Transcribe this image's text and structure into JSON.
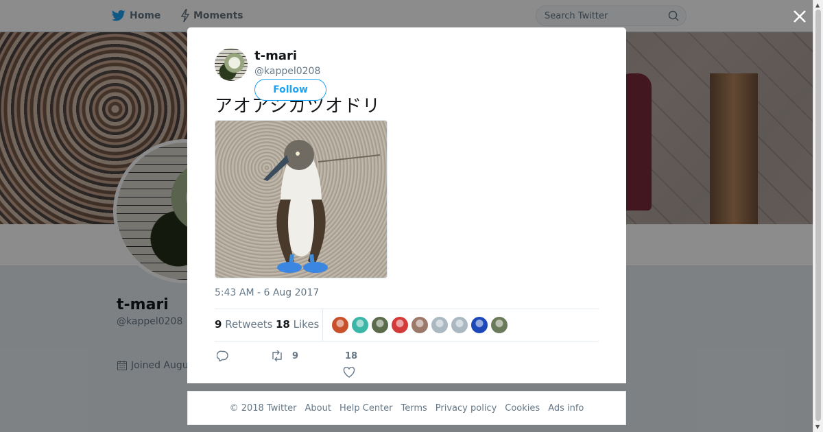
{
  "nav": {
    "home_label": "Home",
    "moments_label": "Moments",
    "search_placeholder": "Search Twitter"
  },
  "profile": {
    "name": "t-mari",
    "handle": "@kappel0208",
    "joined": "Joined Augu"
  },
  "tweet": {
    "author_name": "t-mari",
    "author_handle": "@kappel0208",
    "follow_label": "Follow",
    "text": "アオアシカツオドリ",
    "timestamp": "5:43 AM - 6 Aug 2017",
    "retweets_count": "9",
    "retweets_label": "Retweets",
    "likes_count": "18",
    "likes_label": "Likes",
    "likers": [
      "#c8502a",
      "#3bb6a7",
      "#5b6b4c",
      "#d33b3b",
      "#9c7a6b",
      "#aab8c2",
      "#aab8c2",
      "#1d48b8",
      "#6b7a5a"
    ],
    "reply_count": "",
    "retweet_action_count": "9",
    "like_action_count": "18"
  },
  "footer": {
    "copyright": "© 2018 Twitter",
    "links": [
      "About",
      "Help Center",
      "Terms",
      "Privacy policy",
      "Cookies",
      "Ads info"
    ]
  },
  "colors": {
    "brand": "#1da1f2",
    "muted": "#657786"
  }
}
